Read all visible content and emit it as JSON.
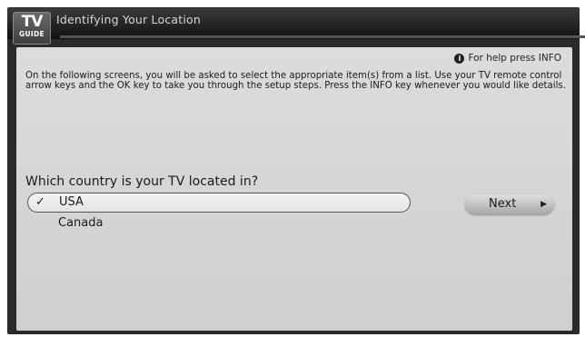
{
  "header": {
    "logo_top": "TV",
    "logo_bottom": "GUIDE",
    "title": "Identifying Your Location"
  },
  "help": {
    "icon": "info-icon",
    "icon_glyph": "i",
    "text": "For help press INFO"
  },
  "instructions": "On the following screens, you will be asked to select the appropriate item(s) from a list. Use your TV remote control arrow keys and the OK key to take you through the setup steps. Press the INFO key whenever you would like details.",
  "question": "Which country is your TV located in?",
  "options": [
    {
      "label": "USA",
      "selected": true,
      "check": "✓"
    },
    {
      "label": "Canada",
      "selected": false
    }
  ],
  "next_button": {
    "label": "Next",
    "arrow": "▶"
  }
}
